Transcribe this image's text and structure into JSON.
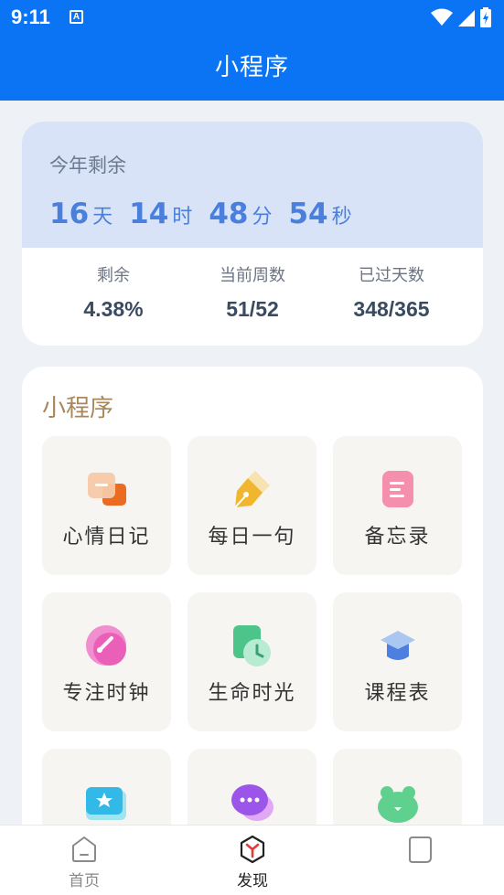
{
  "status_bar": {
    "time": "9:11",
    "notification_icon": "A",
    "icons": [
      "wifi-icon",
      "signal-icon",
      "battery-icon"
    ]
  },
  "header": {
    "title": "小程序"
  },
  "year_card": {
    "label": "今年剩余",
    "countdown": [
      {
        "value": "16",
        "unit": "天"
      },
      {
        "value": "14",
        "unit": "时"
      },
      {
        "value": "48",
        "unit": "分"
      },
      {
        "value": "54",
        "unit": "秒"
      }
    ],
    "stats": [
      {
        "label": "剩余",
        "value": "4.38%"
      },
      {
        "label": "当前周数",
        "value": "51/52"
      },
      {
        "label": "已过天数",
        "value": "348/365"
      }
    ]
  },
  "mini_programs": {
    "title": "小程序",
    "items": [
      {
        "label": "心情日记",
        "icon": "mood-diary-icon"
      },
      {
        "label": "每日一句",
        "icon": "pen-icon"
      },
      {
        "label": "备忘录",
        "icon": "memo-icon"
      },
      {
        "label": "专注时钟",
        "icon": "focus-clock-icon"
      },
      {
        "label": "生命时光",
        "icon": "life-time-icon"
      },
      {
        "label": "课程表",
        "icon": "graduation-cap-icon"
      },
      {
        "label": "",
        "icon": "ticket-star-icon"
      },
      {
        "label": "",
        "icon": "chat-bubble-icon"
      },
      {
        "label": "",
        "icon": "frog-icon"
      }
    ]
  },
  "bottom_nav": {
    "items": [
      {
        "label": "首页",
        "icon": "home-icon",
        "active": false
      },
      {
        "label": "发现",
        "icon": "discover-icon",
        "active": true
      },
      {
        "label": "",
        "icon": "profile-icon",
        "active": false
      }
    ]
  },
  "colors": {
    "brand": "#0a74f4",
    "countdown": "#4a7fdc",
    "section_title": "#a8875a"
  }
}
